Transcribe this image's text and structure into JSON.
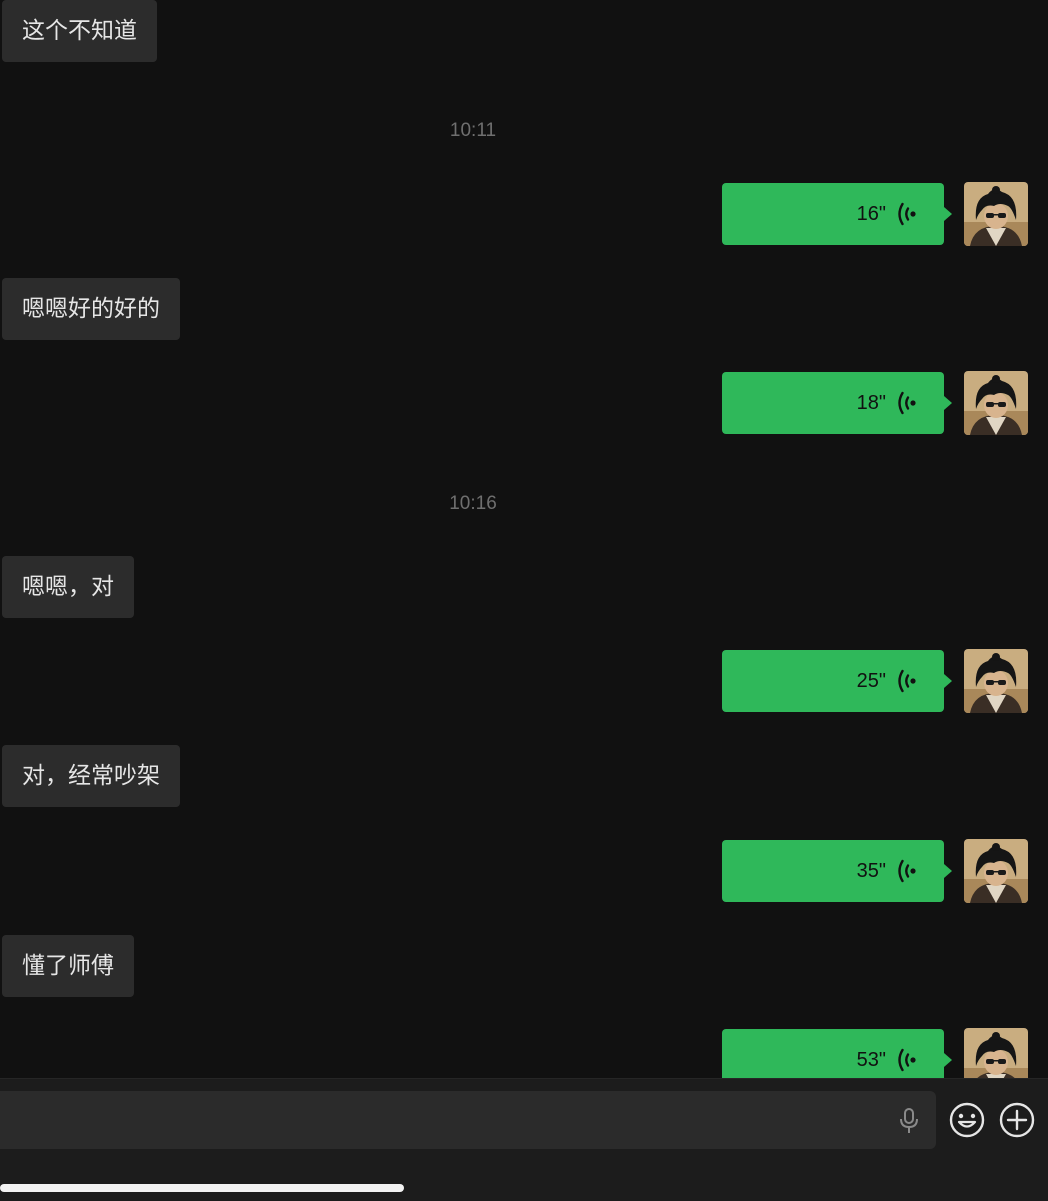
{
  "messages": {
    "m1": "这个不知道",
    "t1": "10:11",
    "v1": "16\"",
    "m2": "嗯嗯好的好的",
    "v2": "18\"",
    "t2": "10:16",
    "m3": "嗯嗯，对",
    "v3": "25\"",
    "m4": "对，经常吵架",
    "v4": "35\"",
    "m5": "懂了师傅",
    "v5": "53\""
  },
  "input": {
    "placeholder": ""
  },
  "icons": {
    "voice": "voice-wave-icon",
    "mic": "microphone-icon",
    "emoji": "emoji-icon",
    "add": "plus-circle-icon"
  },
  "colors": {
    "background": "#111111",
    "incoming_bubble": "#2c2c2c",
    "outgoing_bubble": "#2fb85a",
    "timestamp": "#6f6f6f"
  }
}
